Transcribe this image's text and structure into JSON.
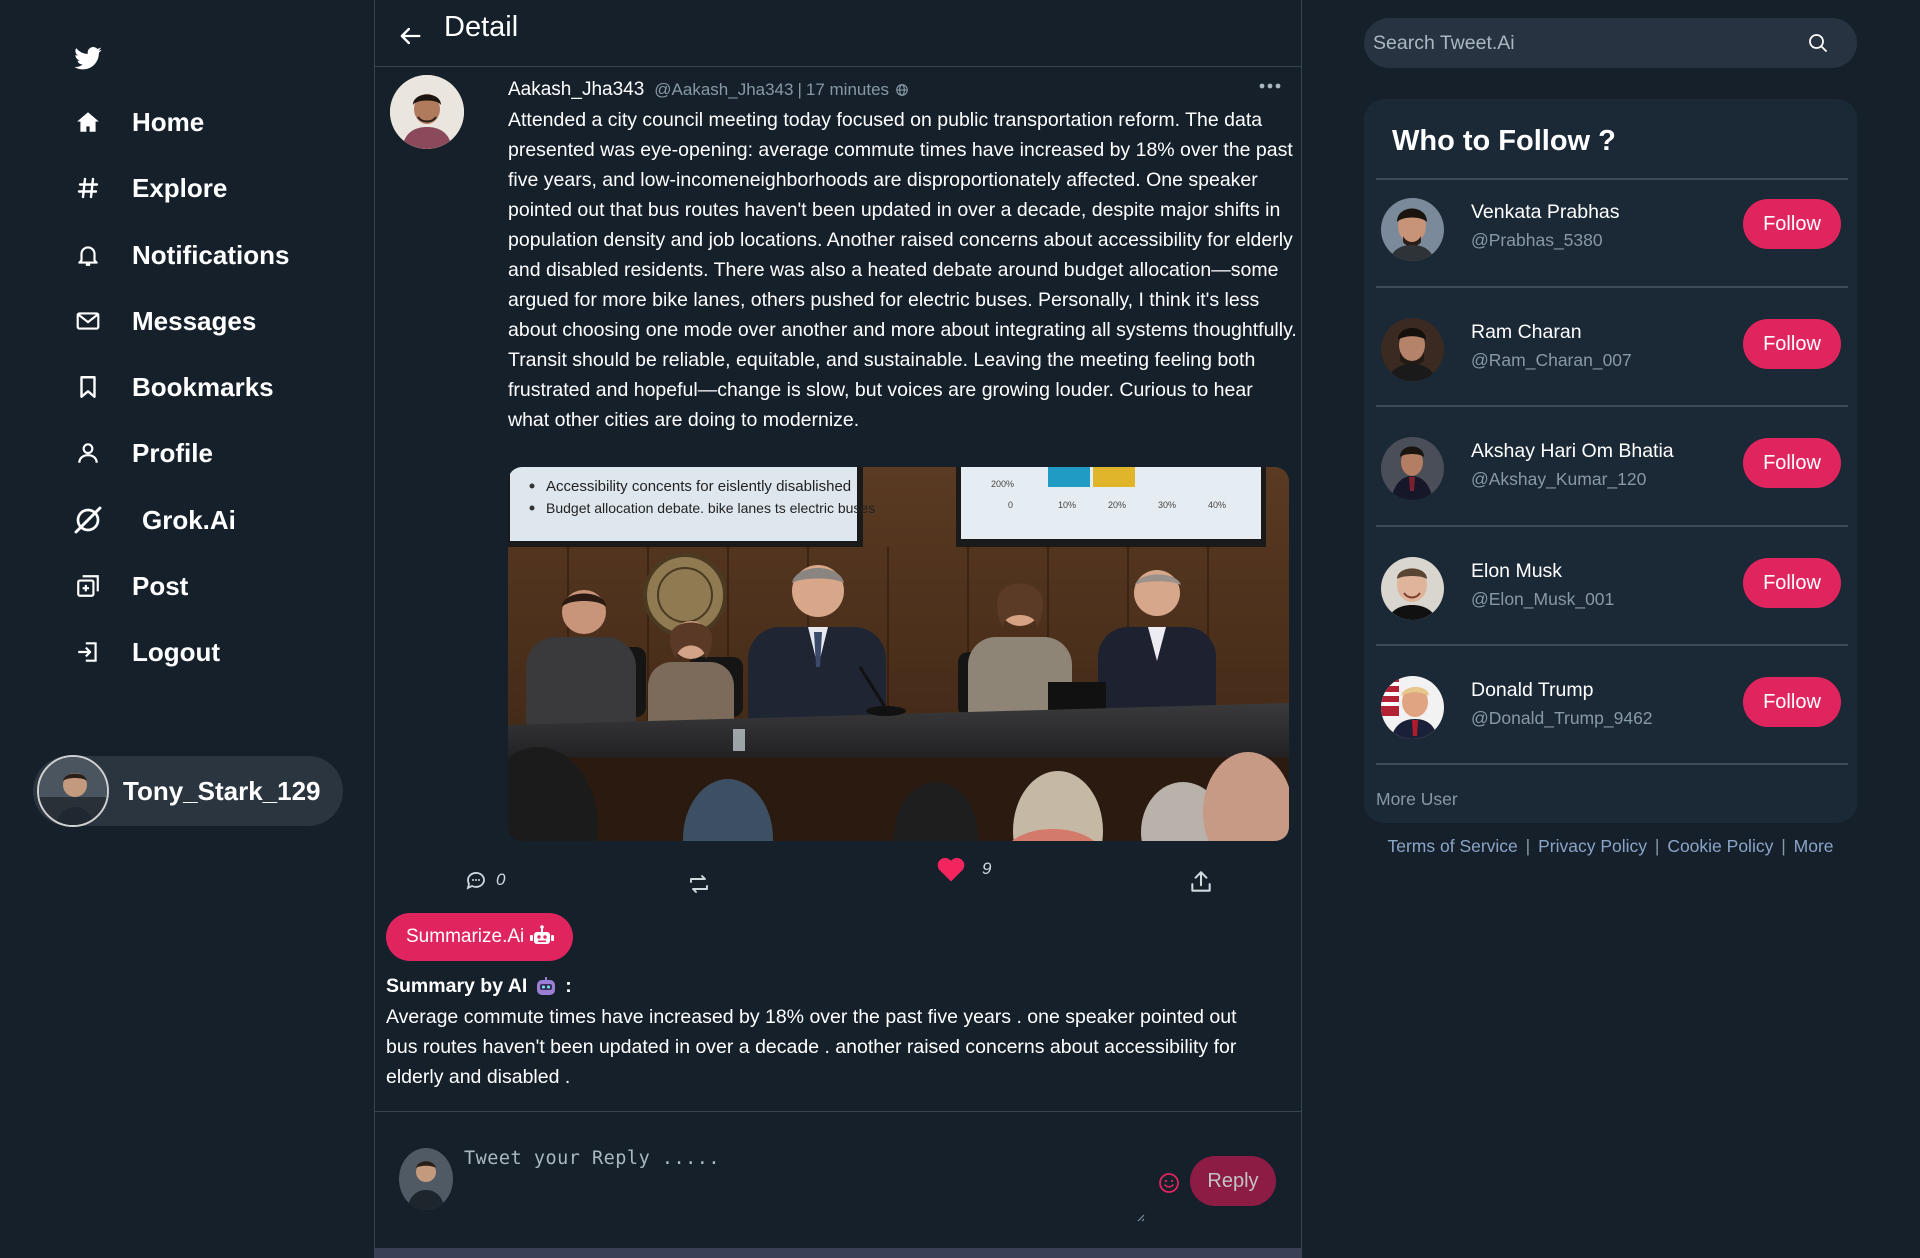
{
  "sidebar": {
    "logo": "twitter-bird-icon",
    "nav": [
      {
        "label": "Home",
        "icon": "home-icon"
      },
      {
        "label": "Explore",
        "icon": "hashtag-icon"
      },
      {
        "label": "Notifications",
        "icon": "bell-icon"
      },
      {
        "label": "Messages",
        "icon": "mail-icon"
      },
      {
        "label": "Bookmarks",
        "icon": "bookmark-icon"
      },
      {
        "label": "Profile",
        "icon": "person-icon"
      },
      {
        "label": "Grok.Ai",
        "icon": "grok-icon"
      },
      {
        "label": "Post",
        "icon": "post-icon"
      },
      {
        "label": "Logout",
        "icon": "logout-icon"
      }
    ],
    "current_user": "Tony_Stark_129"
  },
  "header": {
    "title": "Detail"
  },
  "post": {
    "author": "Aakash_Jha343",
    "handle": "@Aakash_Jha343",
    "separator": "|",
    "time": "17 minutes",
    "text": "Attended a city council meeting today focused on public transportation reform. The data presented was eye-opening: average commute times have increased by 18% over the past five years, and low-incomeneighborhoods are disproportionately affected. One speaker pointed out that bus routes haven't been updated in over a decade, despite major shifts in population density and job locations. Another raised concerns about accessibility for elderly and disabled residents. There was also a heated debate around budget allocation—some argued for more bike lanes, others pushed for electric buses. Personally, I think it's less about choosing one mode over another and more about integrating all systems thoughtfully. Transit should be reliable, equitable, and sustainable. Leaving the meeting feeling both frustrated and hopeful—change is slow, but voices are growing louder. Curious to hear what other cities are doing to modernize.",
    "image": {
      "slide_bullets": [
        "Accessibility concents for eislently disablished",
        "Budget allocation debate. bike lanes ts electric buses"
      ],
      "chart_top_label": "200%",
      "chart_ticks": [
        "0",
        "10%",
        "20%",
        "30%",
        "40%"
      ],
      "seal_text": "CITY SEAL"
    },
    "comments": "0",
    "likes": "9"
  },
  "summarize_button": "Summarize.Ai",
  "summary": {
    "title": "Summary by AI",
    "colon": ":",
    "text": "Average commute times have increased by 18% over the past five years . one speaker pointed out bus routes haven't been updated in over a decade . another raised concerns about accessibility for elderly and disabled ."
  },
  "reply": {
    "placeholder": "Tweet your Reply .....",
    "button": "Reply"
  },
  "search": {
    "placeholder": "Search Tweet.Ai"
  },
  "who_to_follow": {
    "title": "Who to Follow ?",
    "users": [
      {
        "name": "Venkata Prabhas",
        "handle": "@Prabhas_5380",
        "button": "Follow"
      },
      {
        "name": "Ram Charan",
        "handle": "@Ram_Charan_007",
        "button": "Follow"
      },
      {
        "name": "Akshay Hari Om Bhatia",
        "handle": "@Akshay_Kumar_120",
        "button": "Follow"
      },
      {
        "name": "Elon Musk",
        "handle": "@Elon_Musk_001",
        "button": "Follow"
      },
      {
        "name": "Donald Trump",
        "handle": "@Donald_Trump_9462",
        "button": "Follow"
      }
    ],
    "more": "More User"
  },
  "footer": {
    "links": [
      "Terms of Service",
      "Privacy Policy",
      "Cookie Policy",
      "More"
    ],
    "separator": "|"
  },
  "colors": {
    "background": "#15202b",
    "accent": "#e0245e",
    "muted_text": "#8899a6",
    "card": "#1b2836"
  }
}
